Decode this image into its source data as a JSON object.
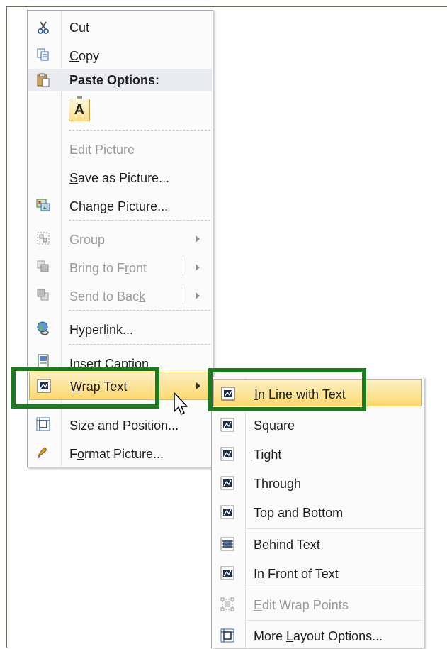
{
  "context_menu": {
    "items": [
      {
        "pre": "Cu",
        "ul": "t",
        "post": "",
        "icon": "scissors-icon"
      },
      {
        "pre": "",
        "ul": "C",
        "post": "opy",
        "icon": "copy-icon"
      },
      {
        "pre": "Paste Options:",
        "ul": "",
        "post": "",
        "icon": "paste-clipboard-icon"
      },
      {
        "pre": "",
        "ul": "E",
        "post": "dit Picture",
        "icon": ""
      },
      {
        "pre": "",
        "ul": "S",
        "post": "ave as Picture...",
        "icon": ""
      },
      {
        "pre": "Chan",
        "ul": "g",
        "post": "e Picture...",
        "icon": "change-picture-icon"
      },
      {
        "pre": "",
        "ul": "G",
        "post": "roup",
        "icon": "group-icon"
      },
      {
        "pre": "Bring to F",
        "ul": "r",
        "post": "ont",
        "icon": "bring-to-front-icon"
      },
      {
        "pre": "Send to Bac",
        "ul": "k",
        "post": "",
        "icon": "send-to-back-icon"
      },
      {
        "pre": "Hyperl",
        "ul": "i",
        "post": "nk...",
        "icon": "hyperlink-globe-icon"
      },
      {
        "pre": "Insert Capt",
        "ul": "",
        "post": "ion...",
        "icon": "insert-caption-icon"
      },
      {
        "pre": "",
        "ul": "W",
        "post": "rap Text",
        "icon": "wrap-text-icon"
      },
      {
        "pre": "S",
        "ul": "i",
        "post": "ze and Position...",
        "icon": "size-position-icon"
      },
      {
        "pre": "F",
        "ul": "o",
        "post": "rmat Picture...",
        "icon": "format-picture-icon"
      }
    ],
    "paste_option_letter": "A"
  },
  "wrap_submenu": {
    "items": [
      {
        "pre": "",
        "ul": "I",
        "post": "n Line with Text",
        "icon": "in-line-with-text-icon"
      },
      {
        "pre": "",
        "ul": "S",
        "post": "quare",
        "icon": "square-wrap-icon"
      },
      {
        "pre": "",
        "ul": "T",
        "post": "ight",
        "icon": "tight-wrap-icon"
      },
      {
        "pre": "T",
        "ul": "h",
        "post": "rough",
        "icon": "through-wrap-icon"
      },
      {
        "pre": "T",
        "ul": "o",
        "post": "p and Bottom",
        "icon": "top-bottom-wrap-icon"
      },
      {
        "pre": "Behin",
        "ul": "d",
        "post": " Text",
        "icon": "behind-text-icon"
      },
      {
        "pre": "I",
        "ul": "n",
        "post": " Front of Text",
        "icon": "in-front-of-text-icon"
      },
      {
        "pre": "",
        "ul": "E",
        "post": "dit Wrap Points",
        "icon": "edit-wrap-points-icon"
      },
      {
        "pre": "More ",
        "ul": "L",
        "post": "ayout Options...",
        "icon": "more-layout-options-icon"
      }
    ]
  },
  "colors": {
    "highlight": "#fbd970",
    "callout": "#1e7a1e",
    "disabled_text": "#9a9a9a"
  }
}
